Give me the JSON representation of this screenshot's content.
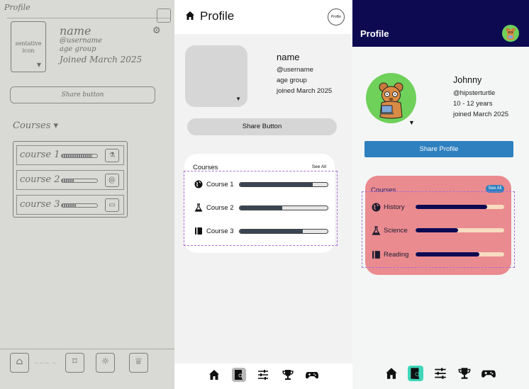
{
  "sketch": {
    "title": "Profile",
    "photo_label": "sentative icon",
    "name": "name",
    "username": "@username",
    "age_group": "age group",
    "joined": "Joined March 2025",
    "share_label": "Share button",
    "courses_header": "Courses",
    "courses": [
      {
        "label": "course 1",
        "progress": 0.85
      },
      {
        "label": "course 2",
        "progress": 0.35
      },
      {
        "label": "course 3",
        "progress": 0.4
      }
    ]
  },
  "wireframe": {
    "title": "Profile",
    "avatar_button_label": "Profile",
    "name": "name",
    "username": "@username",
    "age_group": "age group",
    "joined": "joined March 2025",
    "share_label": "Share Button",
    "courses_header": "Courses",
    "see_all": "See All",
    "courses": [
      {
        "label": "Course 1",
        "icon": "globe-icon",
        "progress": 0.83
      },
      {
        "label": "Course 2",
        "icon": "flask-icon",
        "progress": 0.48
      },
      {
        "label": "Course 3",
        "icon": "book-icon",
        "progress": 0.72
      }
    ],
    "nav": [
      "home-icon",
      "profile-icon",
      "sliders-icon",
      "trophy-icon",
      "gamepad-icon"
    ],
    "colors": {
      "bar": "#3a4553",
      "placeholder": "#d6d6d6"
    }
  },
  "hifi": {
    "title": "Profile",
    "name": "Johnny",
    "username": "@hipsterturtle",
    "age_group": "10 - 12 years",
    "joined": "joined March 2025",
    "share_label": "Share Profile",
    "courses_header": "Courses",
    "see_all": "See All",
    "courses": [
      {
        "label": "History",
        "icon": "globe-icon",
        "progress": 0.81
      },
      {
        "label": "Science",
        "icon": "flask-icon",
        "progress": 0.48
      },
      {
        "label": "Reading",
        "icon": "book-icon",
        "progress": 0.72
      }
    ],
    "nav": [
      "home-icon",
      "profile-icon",
      "sliders-icon",
      "trophy-icon",
      "gamepad-icon"
    ],
    "colors": {
      "header": "#0d0a52",
      "accent": "#2f80bf",
      "card": "#ea8b8f",
      "avatar_bg": "#6fd05a",
      "active_nav": "#3fd6b9"
    }
  }
}
